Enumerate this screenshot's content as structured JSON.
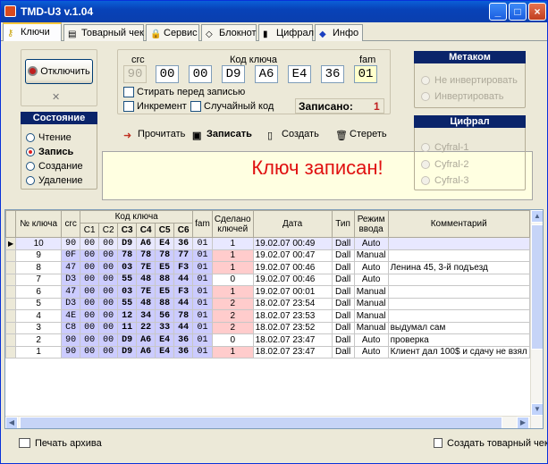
{
  "window": {
    "title": "TMD-U3 v.1.04",
    "min": "_",
    "max": "□",
    "close": "×"
  },
  "tabs": [
    {
      "label": "Ключи"
    },
    {
      "label": "Товарный чек"
    },
    {
      "label": "Сервис"
    },
    {
      "label": "Блокнот"
    },
    {
      "label": "Цифрал"
    },
    {
      "label": "Инфо"
    }
  ],
  "controls": {
    "disconnect_label": "Отключить",
    "crc_label": "crc",
    "key_code_label": "Код ключа",
    "fam_label": "fam",
    "crc_value": "90",
    "key_bytes": [
      "00",
      "00",
      "D9",
      "A6",
      "E4",
      "36"
    ],
    "fam_value": "01",
    "erase_before_write": "Стирать перед записью",
    "increment": "Инкремент",
    "random_code": "Случайный код",
    "written_label": "Записано:",
    "written_count": "1"
  },
  "state": {
    "title": "Состояние",
    "options": [
      "Чтение",
      "Запись",
      "Создание",
      "Удаление"
    ],
    "selected": "Запись"
  },
  "metakom": {
    "title": "Метаком",
    "options": [
      "Не инвертировать",
      "Инвертировать"
    ]
  },
  "cyfral": {
    "title": "Цифрал",
    "options": [
      "Cyfral-1",
      "Cyfral-2",
      "Cyfral-3"
    ]
  },
  "actions": {
    "read": "Прочитать",
    "write": "Записать",
    "create": "Создать",
    "erase": "Стереть"
  },
  "message": "Ключ записан!",
  "table": {
    "headers": {
      "num": "№ ключа",
      "crc": "crc",
      "key_code": "Код ключа",
      "c": [
        "C1",
        "C2",
        "C3",
        "C4",
        "C5",
        "C6"
      ],
      "fam": "fam",
      "made": "Сделано ключей",
      "date": "Дата",
      "type": "Тип",
      "mode": "Режим ввода",
      "comment": "Комментарий"
    },
    "rows": [
      {
        "num": "10",
        "crc": "90",
        "c": [
          "00",
          "00",
          "D9",
          "A6",
          "E4",
          "36"
        ],
        "fam": "01",
        "made": "1",
        "date": "19.02.07 00:49",
        "type": "Dall",
        "mode": "Auto",
        "comment": ""
      },
      {
        "num": "9",
        "crc": "0F",
        "c": [
          "00",
          "00",
          "78",
          "78",
          "78",
          "77"
        ],
        "fam": "01",
        "made": "1",
        "date": "19.02.07 00:47",
        "type": "Dall",
        "mode": "Manual",
        "comment": ""
      },
      {
        "num": "8",
        "crc": "47",
        "c": [
          "00",
          "00",
          "03",
          "7E",
          "E5",
          "F3"
        ],
        "fam": "01",
        "made": "1",
        "date": "19.02.07 00:46",
        "type": "Dall",
        "mode": "Auto",
        "comment": "Ленина 45, 3-й подъезд"
      },
      {
        "num": "7",
        "crc": "D3",
        "c": [
          "00",
          "00",
          "55",
          "48",
          "88",
          "44"
        ],
        "fam": "01",
        "made": "0",
        "date": "19.02.07 00:46",
        "type": "Dall",
        "mode": "Auto",
        "comment": ""
      },
      {
        "num": "6",
        "crc": "47",
        "c": [
          "00",
          "00",
          "03",
          "7E",
          "E5",
          "F3"
        ],
        "fam": "01",
        "made": "1",
        "date": "19.02.07 00:01",
        "type": "Dall",
        "mode": "Manual",
        "comment": ""
      },
      {
        "num": "5",
        "crc": "D3",
        "c": [
          "00",
          "00",
          "55",
          "48",
          "88",
          "44"
        ],
        "fam": "01",
        "made": "2",
        "date": "18.02.07 23:54",
        "type": "Dall",
        "mode": "Manual",
        "comment": ""
      },
      {
        "num": "4",
        "crc": "4E",
        "c": [
          "00",
          "00",
          "12",
          "34",
          "56",
          "78"
        ],
        "fam": "01",
        "made": "2",
        "date": "18.02.07 23:53",
        "type": "Dall",
        "mode": "Manual",
        "comment": ""
      },
      {
        "num": "3",
        "crc": "C8",
        "c": [
          "00",
          "00",
          "11",
          "22",
          "33",
          "44"
        ],
        "fam": "01",
        "made": "2",
        "date": "18.02.07 23:52",
        "type": "Dall",
        "mode": "Manual",
        "comment": "выдумал сам"
      },
      {
        "num": "2",
        "crc": "90",
        "c": [
          "00",
          "00",
          "D9",
          "A6",
          "E4",
          "36"
        ],
        "fam": "01",
        "made": "0",
        "date": "18.02.07 23:47",
        "type": "Dall",
        "mode": "Auto",
        "comment": "проверка"
      },
      {
        "num": "1",
        "crc": "90",
        "c": [
          "00",
          "00",
          "D9",
          "A6",
          "E4",
          "36"
        ],
        "fam": "01",
        "made": "1",
        "date": "18.02.07 23:47",
        "type": "Dall",
        "mode": "Auto",
        "comment": "Клиент дал 100$ и сдачу не взял"
      }
    ]
  },
  "bottom": {
    "print_archive": "Печать архива",
    "create_receipt": "Создать товарный чек"
  },
  "colors": {
    "hex_cell": "#ccccff",
    "made_cell": "#ffcccc",
    "message_text": "#e01010",
    "group_header": "#0a246a"
  }
}
